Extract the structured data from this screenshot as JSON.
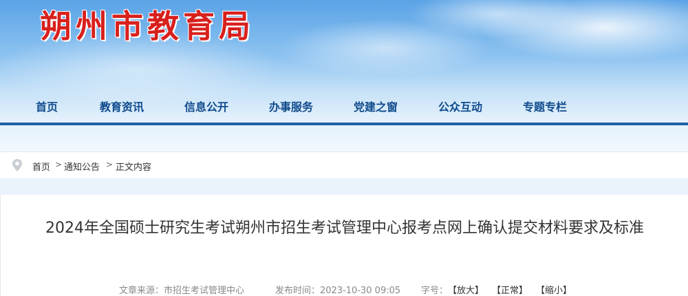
{
  "header": {
    "site_title": "朔州市教育局"
  },
  "nav": {
    "items": [
      {
        "label": "首页"
      },
      {
        "label": "教育资讯"
      },
      {
        "label": "信息公开"
      },
      {
        "label": "办事服务"
      },
      {
        "label": "党建之窗"
      },
      {
        "label": "公众互动"
      },
      {
        "label": "专题专栏"
      }
    ]
  },
  "breadcrumb": {
    "icon": "location-pin-icon",
    "items": [
      "首页",
      "通知公告",
      "正文内容"
    ],
    "separator": ">"
  },
  "article": {
    "title": "2024年全国硕士研究生考试朔州市招生考试管理中心报考点网上确认提交材料要求及标准",
    "source_label": "文章来源：市招生考试管理中心",
    "time_label": "发布时间：2023-10-30 09:05",
    "font_size_label": "字号：",
    "font_large": "【放大】",
    "font_normal": "【正常】",
    "font_small": "【缩小】"
  },
  "colors": {
    "title_red": "#d8201d",
    "nav_blue": "#0f4a8c",
    "nav_bar": "#1f5fa8"
  }
}
